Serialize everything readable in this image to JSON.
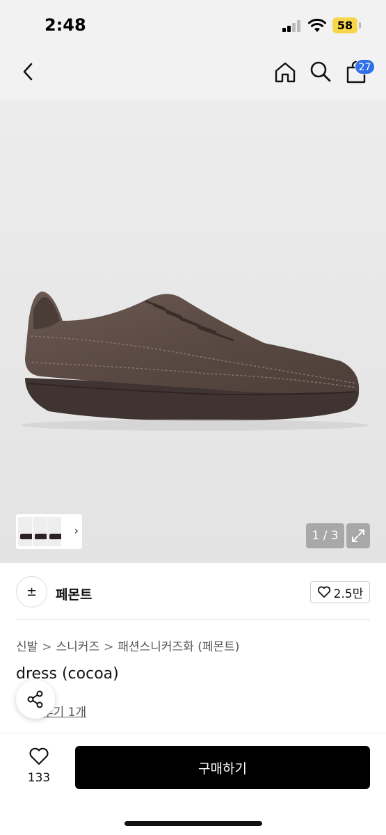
{
  "status_bar": {
    "time": "2:48",
    "battery": "58",
    "battery_color": "#f6d64b"
  },
  "nav": {
    "back_icon": "chevron-left-icon",
    "home_icon": "home-icon",
    "search_icon": "search-icon",
    "cart_icon": "shopping-bag-icon",
    "cart_count": "27",
    "badge_color": "#2f6fe8"
  },
  "gallery": {
    "page_indicator": "1 / 3",
    "expand_icon": "expand-icon",
    "thumbs_arrow": "›"
  },
  "store": {
    "logo_glyph": "±",
    "name": "페몬트",
    "follow_count": "2.5만",
    "follow_icon": "heart-outline-icon"
  },
  "breadcrumb": {
    "items": [
      "신발",
      "스니커즈",
      "패션스니커즈화 (페몬트)"
    ],
    "separator": ">"
  },
  "product": {
    "title": "dress (cocoa)",
    "review_text": "후기 1개"
  },
  "bottom_bar": {
    "like_count": "133",
    "buy_label": "구매하기",
    "share_icon": "share-icon"
  }
}
